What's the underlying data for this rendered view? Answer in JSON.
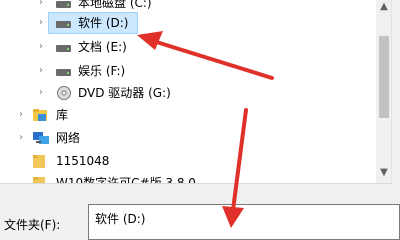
{
  "tree": {
    "items": [
      {
        "label": "本地磁盘 (C:)",
        "icon": "drive-icon",
        "expander": "›"
      },
      {
        "label": "软件 (D:)",
        "icon": "drive-icon",
        "expander": "›",
        "selected": true
      },
      {
        "label": "文档 (E:)",
        "icon": "drive-icon",
        "expander": "›"
      },
      {
        "label": "娱乐 (F:)",
        "icon": "drive-icon",
        "expander": "›"
      },
      {
        "label": "DVD 驱动器 (G:)",
        "icon": "dvd-icon",
        "expander": "›"
      },
      {
        "label": "库",
        "icon": "library-icon",
        "expander": "›"
      },
      {
        "label": "网络",
        "icon": "network-icon",
        "expander": "›"
      },
      {
        "label": "1151048",
        "icon": "folder-icon",
        "expander": ""
      },
      {
        "label": "W10数字许可C#版 3.8.0",
        "icon": "folder-icon",
        "expander": ""
      }
    ]
  },
  "scrollbar": {
    "up_glyph": "▲",
    "down_glyph": "▼"
  },
  "folder": {
    "label": "文件夹(F):",
    "value": "软件 (D:)"
  },
  "colors": {
    "arrow": "#e0302a",
    "selection": "#cce8ff"
  }
}
